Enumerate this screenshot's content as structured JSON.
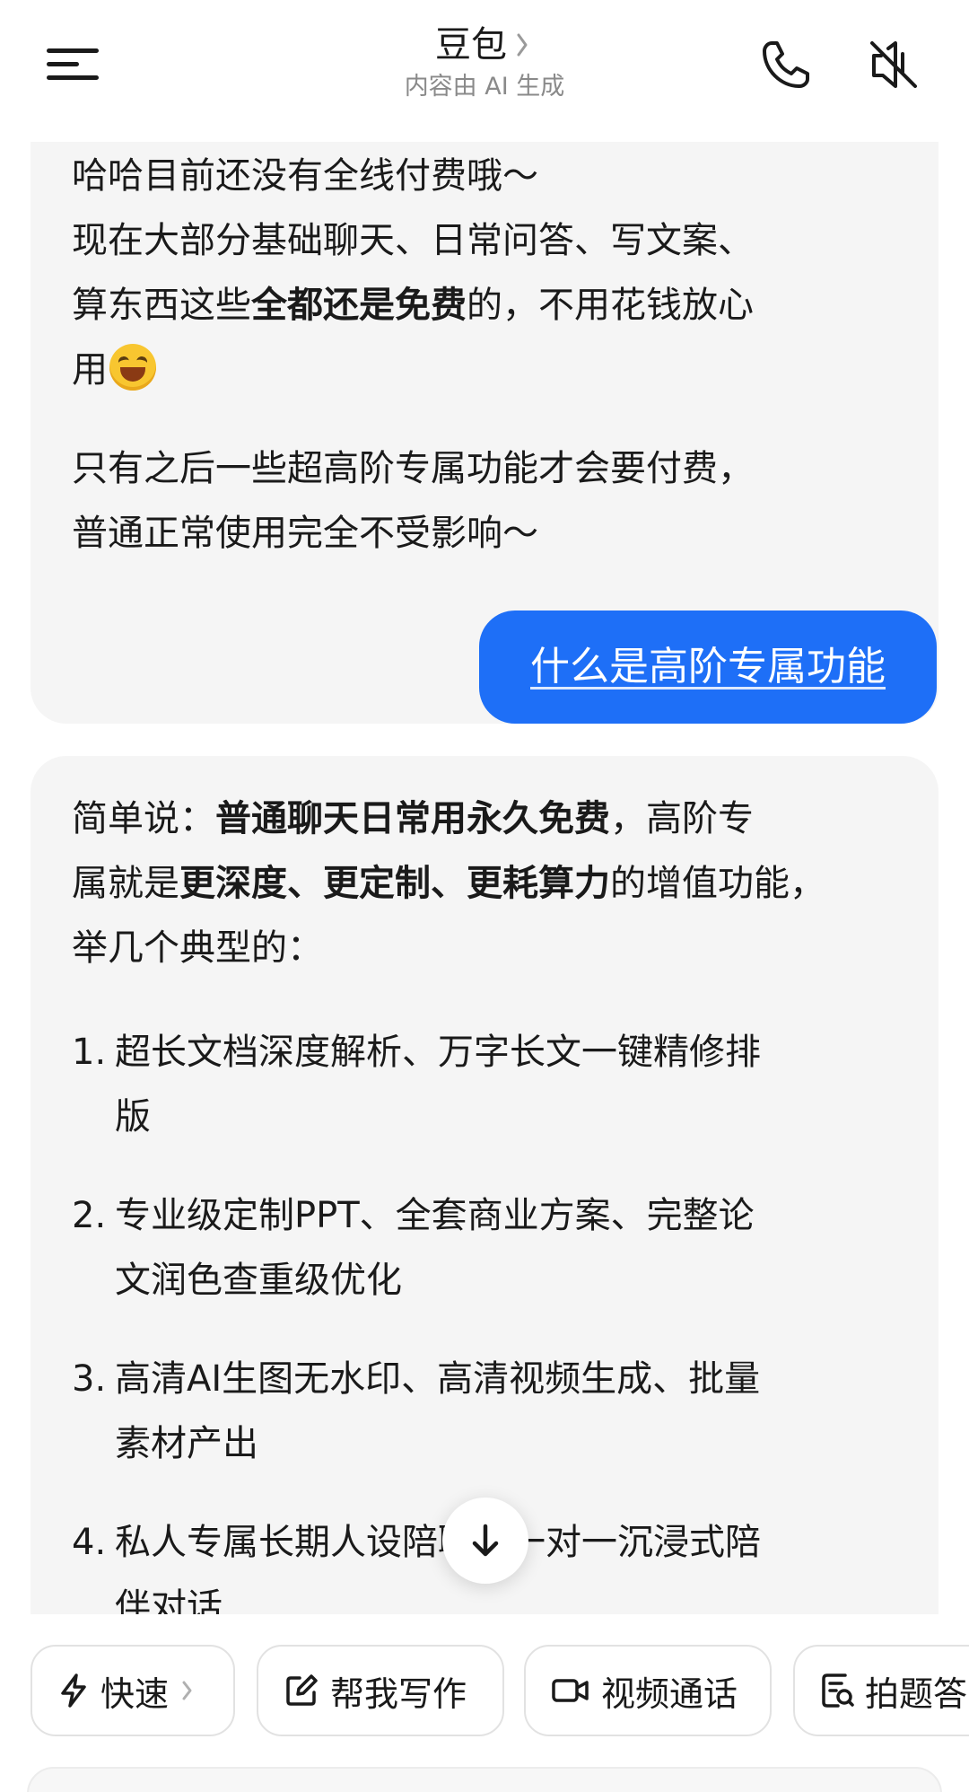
{
  "header": {
    "title": "豆包",
    "subtitle": "内容由 AI 生成"
  },
  "messages": {
    "ai1": {
      "p1_line1": "哈哈目前还没有全线付费哦～",
      "p1_line2": "现在大部分基础聊天、日常问答、写文案、",
      "p1_pre": "算东西这些",
      "p1_bold": "全都还是免费",
      "p1_post": "的，不用花钱放心",
      "p1_end": "用",
      "p2_line1": "只有之后一些超高阶专属功能才会要付费，",
      "p2_line2": "普通正常使用完全不受影响～"
    },
    "user1": "什么是高阶专属功能",
    "ai2": {
      "intro_pre": "简单说：",
      "intro_bold1": "普通聊天日常用永久免费",
      "intro_mid": "，高阶专",
      "intro_pre2": "属就是",
      "intro_bold2": "更深度、更定制、更耗算力",
      "intro_post": "的增值功能，",
      "intro_end": "举几个典型的：",
      "items": [
        {
          "num": "1.",
          "line1": "超长文档深度解析、万字长文一键精修排",
          "line2": "版"
        },
        {
          "num": "2.",
          "line1": "专业级定制PPT、全套商业方案、完整论",
          "line2": "文润色查重级优化"
        },
        {
          "num": "3.",
          "line1": "高清AI生图无水印、高清视频生成、批量",
          "line2": "素材产出"
        },
        {
          "num": "4.",
          "line1": "私人专属长期人设陪聊、一对一沉浸式陪",
          "line2": "伴对话"
        }
      ]
    }
  },
  "quick_actions": {
    "fast": "快速",
    "write": "帮我写作",
    "video": "视频通话",
    "photo": "拍题答"
  },
  "icons": {
    "menu": "menu-icon",
    "phone": "phone-icon",
    "mute": "mute-icon",
    "scroll": "arrow-down-icon",
    "fast": "lightning-icon",
    "write": "edit-icon",
    "video": "video-camera-icon",
    "photo": "photo-question-icon"
  },
  "colors": {
    "user_bubble": "#1e6ff7",
    "ai_bubble": "#f5f5f5"
  }
}
